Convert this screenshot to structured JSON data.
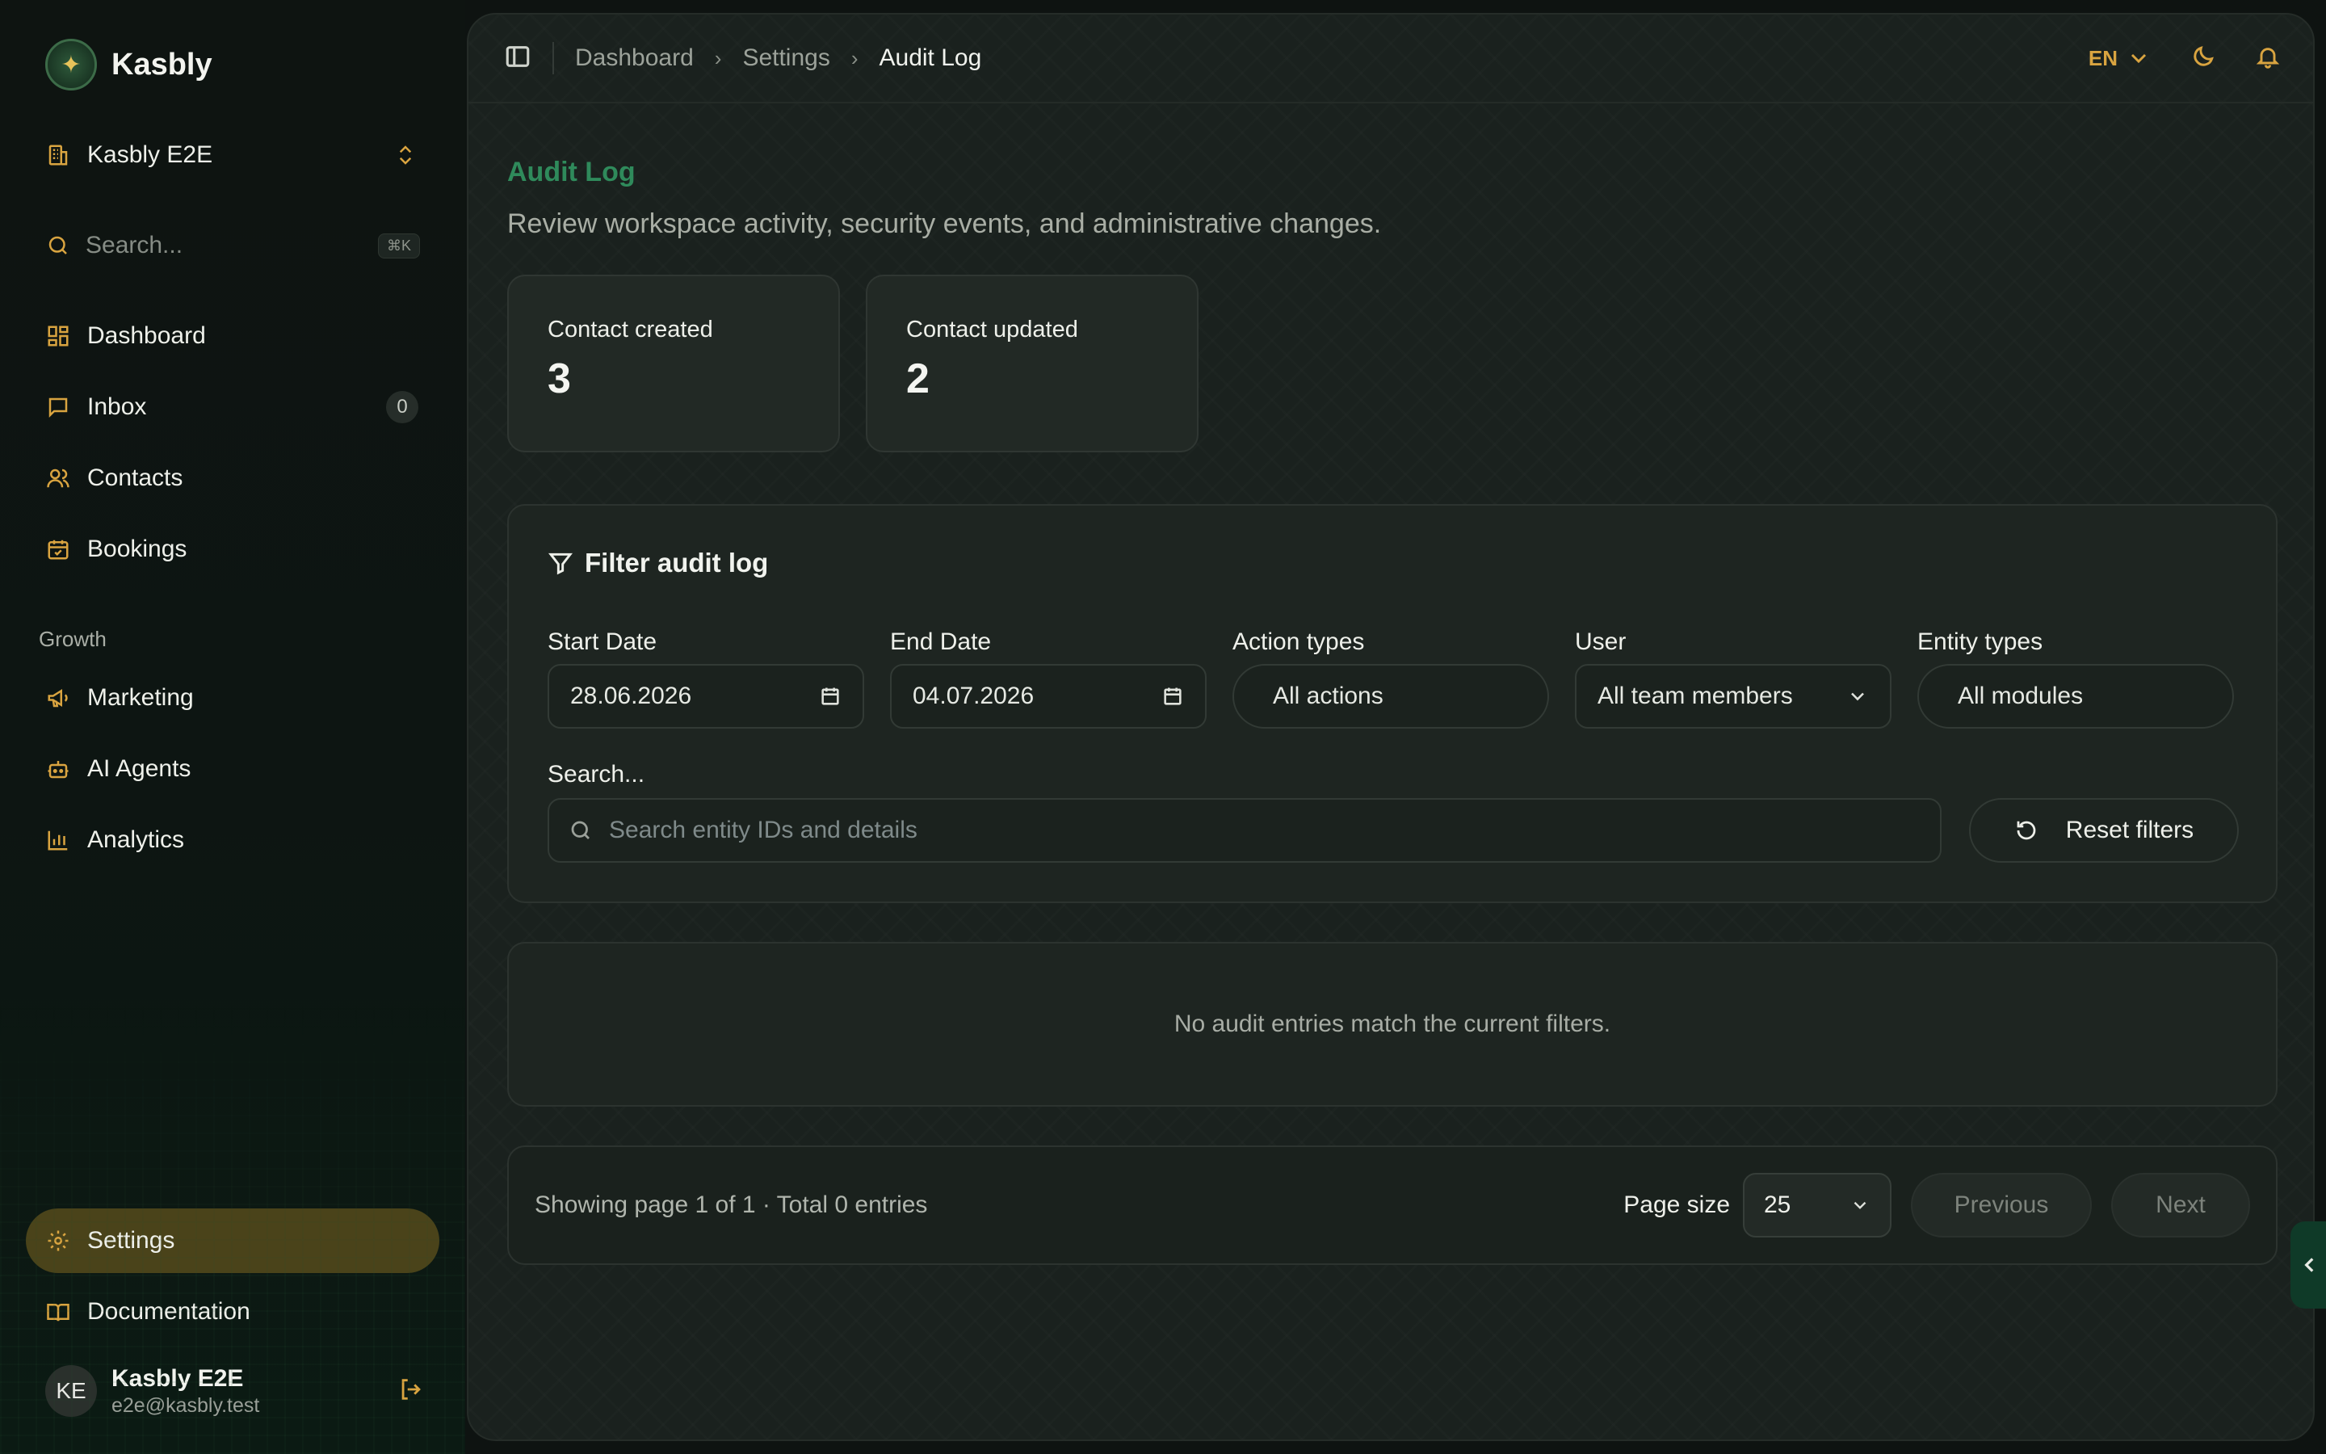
{
  "app": {
    "name": "Kasbly"
  },
  "workspace": {
    "name": "Kasbly E2E"
  },
  "sidebar": {
    "search_placeholder": "Search...",
    "search_shortcut": "⌘K",
    "items": [
      {
        "label": "Dashboard",
        "icon": "dashboard-icon"
      },
      {
        "label": "Inbox",
        "icon": "inbox-icon",
        "badge": "0"
      },
      {
        "label": "Contacts",
        "icon": "contacts-icon"
      },
      {
        "label": "Bookings",
        "icon": "calendar-icon"
      }
    ],
    "growth_section": "Growth",
    "growth_items": [
      {
        "label": "Marketing",
        "icon": "megaphone-icon"
      },
      {
        "label": "AI Agents",
        "icon": "bot-icon"
      },
      {
        "label": "Analytics",
        "icon": "bar-chart-icon"
      }
    ],
    "bottom_items": [
      {
        "label": "Settings",
        "icon": "gear-icon",
        "active": true
      },
      {
        "label": "Documentation",
        "icon": "book-icon"
      }
    ],
    "user": {
      "initials": "KE",
      "name": "Kasbly E2E",
      "email": "e2e@kasbly.test"
    }
  },
  "topbar": {
    "breadcrumbs": [
      "Dashboard",
      "Settings",
      "Audit Log"
    ],
    "language": "EN"
  },
  "page": {
    "title": "Audit Log",
    "subtitle": "Review workspace activity, security events, and administrative changes."
  },
  "stats": [
    {
      "label": "Contact created",
      "value": "3"
    },
    {
      "label": "Contact updated",
      "value": "2"
    }
  ],
  "filters": {
    "title": "Filter audit log",
    "start_date_label": "Start Date",
    "start_date_value": "28.06.2026",
    "end_date_label": "End Date",
    "end_date_value": "04.07.2026",
    "action_types_label": "Action types",
    "action_types_value": "All actions",
    "user_label": "User",
    "user_value": "All team members",
    "entity_types_label": "Entity types",
    "entity_types_value": "All modules",
    "search_label": "Search...",
    "search_placeholder": "Search entity IDs and details",
    "reset_label": "Reset filters"
  },
  "results": {
    "empty_message": "No audit entries match the current filters."
  },
  "pagination": {
    "info": "Showing page 1 of 1 · Total 0 entries",
    "page_size_label": "Page size",
    "page_size_value": "25",
    "previous_label": "Previous",
    "next_label": "Next"
  },
  "colors": {
    "accent": "#d9a440",
    "title_green": "#2f8a5b",
    "active_nav": "#4a431a"
  }
}
